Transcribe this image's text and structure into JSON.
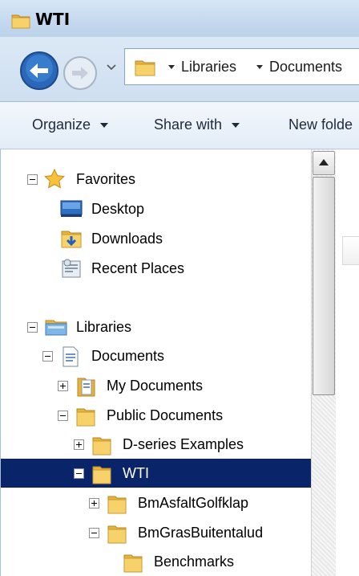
{
  "window": {
    "title": "WTI"
  },
  "address": {
    "crumbs": [
      "Libraries",
      "Documents"
    ]
  },
  "toolbar": {
    "organize_label": "Organize",
    "share_label": "Share with",
    "new_folder_label": "New folde"
  },
  "tree": {
    "favorites": {
      "label": "Favorites",
      "expanded": true
    },
    "desktop": {
      "label": "Desktop"
    },
    "downloads": {
      "label": "Downloads"
    },
    "recent_places": {
      "label": "Recent Places"
    },
    "libraries": {
      "label": "Libraries",
      "expanded": true
    },
    "documents": {
      "label": "Documents",
      "expanded": true
    },
    "my_documents": {
      "label": "My Documents",
      "expanded": false
    },
    "public_documents": {
      "label": "Public Documents",
      "expanded": true
    },
    "dseries_examples": {
      "label": "D-series Examples",
      "expanded": false
    },
    "wti": {
      "label": "WTI",
      "expanded": true,
      "selected": true
    },
    "bm_asfalt": {
      "label": "BmAsfaltGolfklap",
      "expanded": false
    },
    "bm_gras": {
      "label": "BmGrasBuitentalud",
      "expanded": true
    },
    "benchmarks": {
      "label": "Benchmarks"
    }
  },
  "colors": {
    "selection": "#0a246a",
    "titlebar": "#c4d8ee",
    "folder": "#f2c94c"
  }
}
